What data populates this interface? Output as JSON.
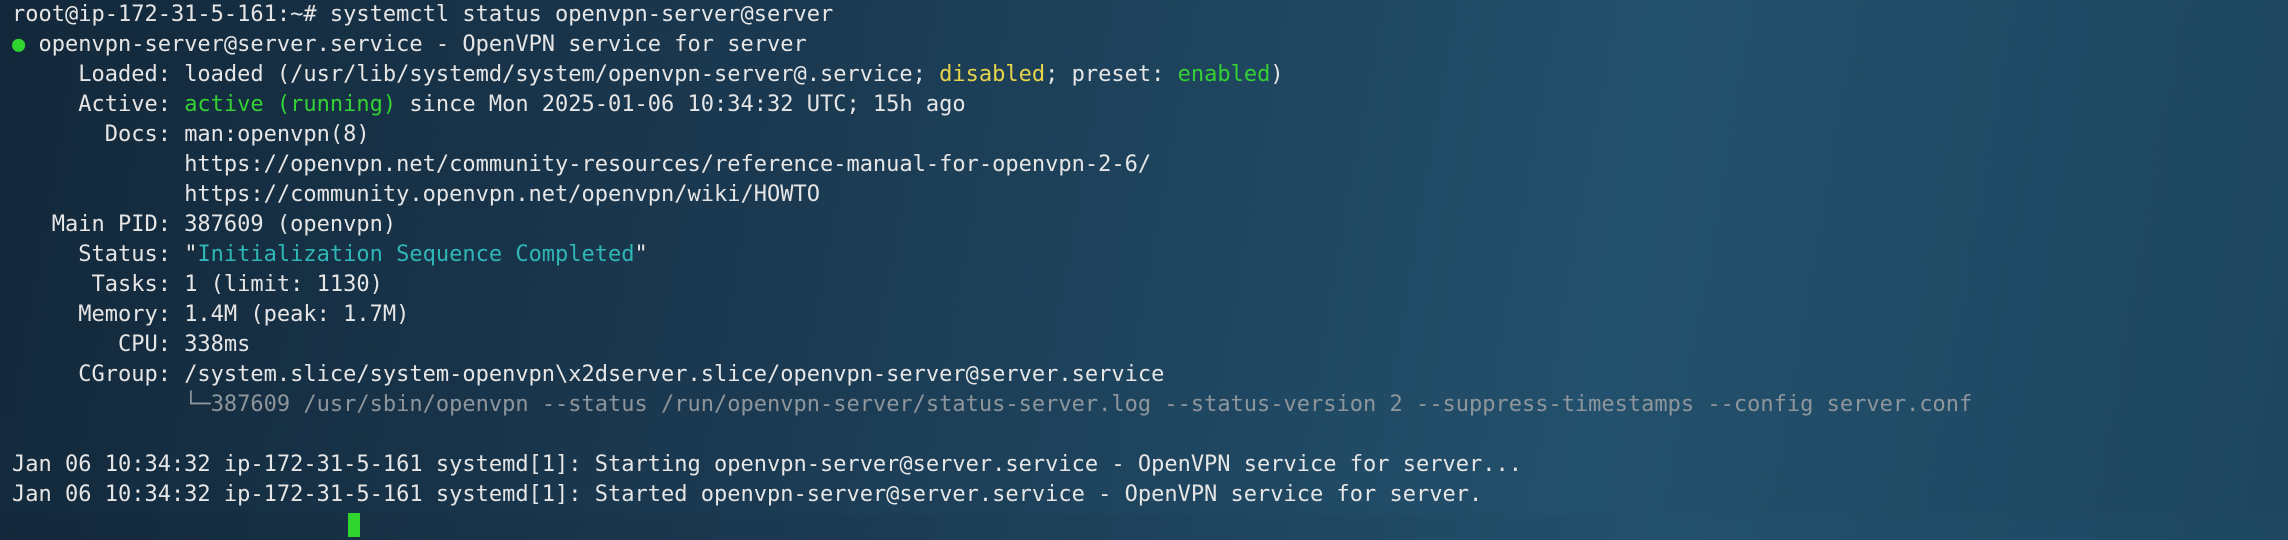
{
  "prompt": {
    "text": "root@ip-172-31-5-161:~# systemctl status openvpn-server@server"
  },
  "service": {
    "bullet": "●",
    "header": " openvpn-server@server.service - OpenVPN service for server"
  },
  "loaded": {
    "key": "     Loaded: ",
    "prefix": "loaded (/usr/lib/systemd/system/openvpn-server@.service; ",
    "state": "disabled",
    "mid": "; preset: ",
    "preset": "enabled",
    "suffix": ")"
  },
  "active": {
    "key": "     Active: ",
    "state": "active (running)",
    "since": " since Mon 2025-01-06 10:34:32 UTC; 15h ago"
  },
  "docs": {
    "key": "       Docs: ",
    "items": [
      "man:openvpn(8)",
      "https://openvpn.net/community-resources/reference-manual-for-openvpn-2-6/",
      "https://community.openvpn.net/openvpn/wiki/HOWTO"
    ],
    "indent": "             "
  },
  "main_pid": {
    "key": "   Main PID: ",
    "value": "387609 (openvpn)"
  },
  "status": {
    "key": "     Status: ",
    "quote_open": "\"",
    "value": "Initialization Sequence Completed",
    "quote_close": "\""
  },
  "tasks": {
    "key": "      Tasks: ",
    "value": "1 (limit: 1130)"
  },
  "memory": {
    "key": "     Memory: ",
    "value": "1.4M (peak: 1.7M)"
  },
  "cpu": {
    "key": "        CPU: ",
    "value": "338ms"
  },
  "cgroup": {
    "key": "     CGroup: ",
    "value": "/system.slice/system-openvpn\\x2dserver.slice/openvpn-server@server.service",
    "indent": "             ",
    "tree": "└─",
    "process": "387609 /usr/sbin/openvpn --status /run/openvpn-server/status-server.log --status-version 2 --suppress-timestamps --config server.conf"
  },
  "log": [
    "Jan 06 10:34:32 ip-172-31-5-161 systemd[1]: Starting openvpn-server@server.service - OpenVPN service for server...",
    "Jan 06 10:34:32 ip-172-31-5-161 systemd[1]: Started openvpn-server@server.service - OpenVPN service for server."
  ],
  "colors": {
    "green": "#34d134",
    "yellow": "#e6d44a",
    "cyan": "#2fb6b6",
    "grey": "#8e969c",
    "cursor": "#2fd42f"
  }
}
